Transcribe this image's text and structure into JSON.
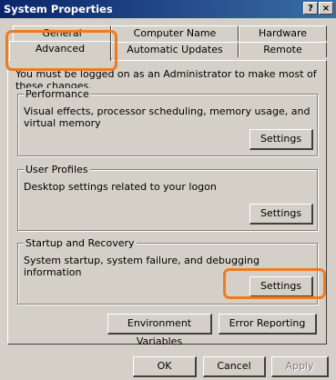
{
  "window": {
    "title": "System Properties",
    "help_btn": "?",
    "close_btn": "×"
  },
  "tabs_row1": [
    {
      "label": "General"
    },
    {
      "label": "Computer Name"
    },
    {
      "label": "Hardware"
    }
  ],
  "tabs_row2": [
    {
      "label": "Advanced",
      "active": true
    },
    {
      "label": "Automatic Updates"
    },
    {
      "label": "Remote"
    }
  ],
  "intro": "You must be logged on as an Administrator to make most of these changes.",
  "groups": {
    "performance": {
      "title": "Performance",
      "desc": "Visual effects, processor scheduling, memory usage, and virtual memory",
      "button": "Settings"
    },
    "user_profiles": {
      "title": "User Profiles",
      "desc": "Desktop settings related to your logon",
      "button": "Settings"
    },
    "startup_recovery": {
      "title": "Startup and Recovery",
      "desc": "System startup, system failure, and debugging information",
      "button": "Settings"
    }
  },
  "bottom_buttons": {
    "env_vars": "Environment Variables",
    "error_reporting": "Error Reporting"
  },
  "dialog_buttons": {
    "ok": "OK",
    "cancel": "Cancel",
    "apply": "Apply"
  },
  "highlight_color": "#f07a1e"
}
